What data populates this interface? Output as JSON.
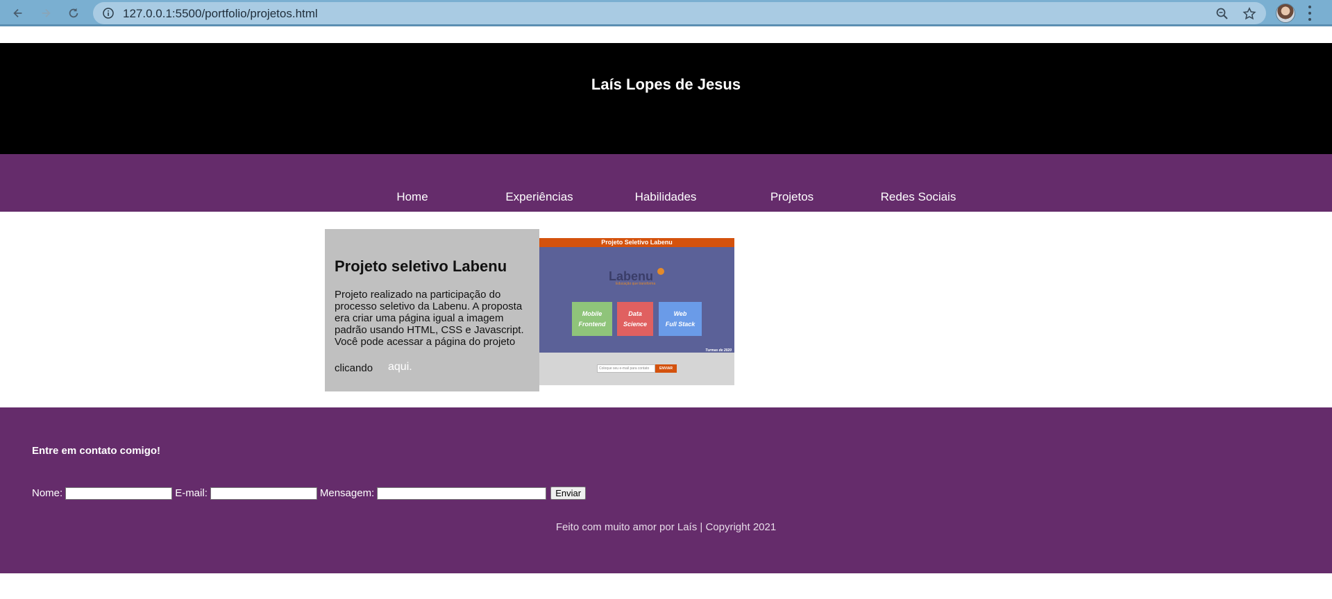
{
  "browser": {
    "url": "127.0.0.1:5500/portfolio/projetos.html"
  },
  "header": {
    "title": "Laís Lopes de Jesus"
  },
  "nav": {
    "items": [
      {
        "label": "Home"
      },
      {
        "label": "Experiências"
      },
      {
        "label": "Habilidades"
      },
      {
        "label": "Projetos"
      },
      {
        "label": "Redes Sociais"
      }
    ]
  },
  "project": {
    "title": "Projeto seletivo Labenu",
    "description": "Projeto realizado na participação do processo seletivo da Labenu. A proposta era criar uma página igual a imagem padrão usando HTML, CSS e Javascript. Você pode acessar a página do projeto",
    "click_text": "clicando",
    "link_text": "aqui.",
    "thumbnail": {
      "banner": "Projeto Seletivo Labenu",
      "logo": "Labenu",
      "tagline": "Educação que transforma",
      "boxes": [
        {
          "line1": "Mobile",
          "line2": "Frontend",
          "color": "#8fc47a"
        },
        {
          "line1": "Data",
          "line2": "Science",
          "color": "#e06060"
        },
        {
          "line1": "Web",
          "line2": "Full Stack",
          "color": "#6a9be8"
        }
      ],
      "turmas": "Turmas de 2020",
      "input_placeholder": "Coloque seu e-mail para contato",
      "button": "ENVIAR"
    }
  },
  "footer": {
    "contact_title": "Entre em contato comigo!",
    "name_label": "Nome:",
    "email_label": "E-mail:",
    "message_label": "Mensagem:",
    "send_label": "Enviar",
    "copyright": "Feito com muito amor por Laís | Copyright 2021"
  },
  "colors": {
    "purple": "#652c6b",
    "header_bg": "#000000",
    "card_bg": "#c0c0c0"
  }
}
